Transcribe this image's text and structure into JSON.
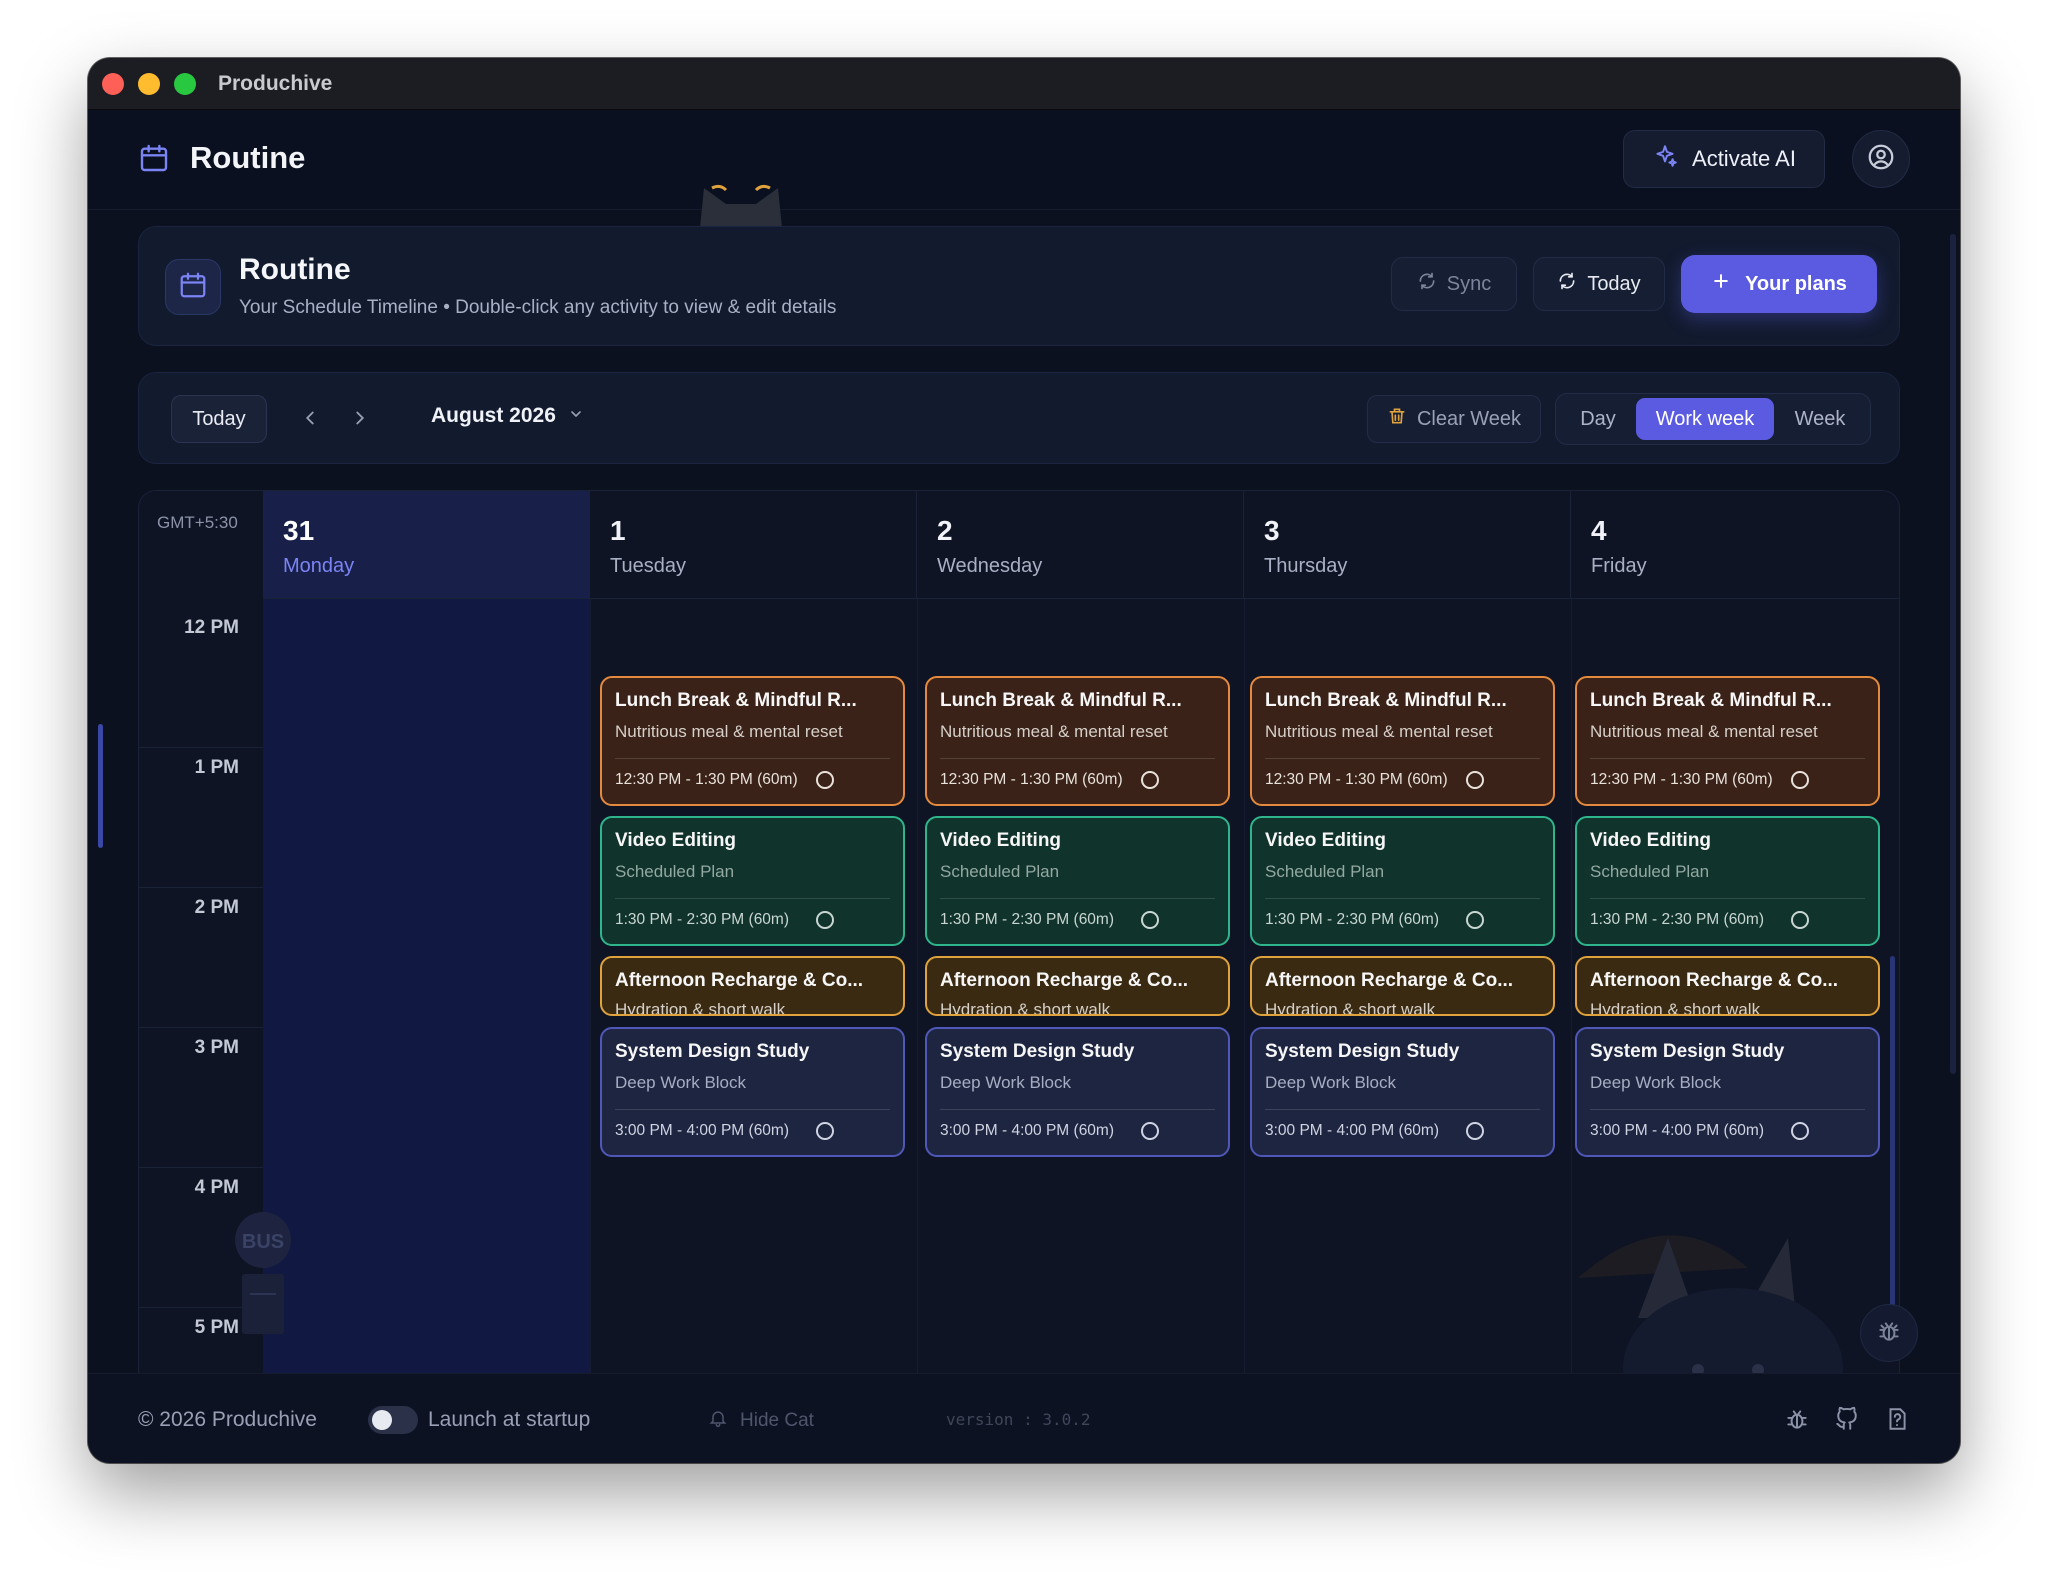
{
  "window": {
    "title": "Produchive"
  },
  "header": {
    "title": "Routine",
    "activate_ai": "Activate AI"
  },
  "routine_card": {
    "title": "Routine",
    "subtitle": "Your Schedule Timeline • Double-click any activity to view & edit details",
    "sync": "Sync",
    "today": "Today",
    "your_plans": "Your plans"
  },
  "toolbar": {
    "today": "Today",
    "month": "August 2026",
    "clear_week": "Clear Week",
    "views": {
      "day": "Day",
      "work_week": "Work week",
      "week": "Week"
    },
    "selected_view": "Work week"
  },
  "calendar": {
    "timezone": "GMT+5:30",
    "days": [
      {
        "num": "31",
        "name": "Monday",
        "today": true
      },
      {
        "num": "1",
        "name": "Tuesday"
      },
      {
        "num": "2",
        "name": "Wednesday"
      },
      {
        "num": "3",
        "name": "Thursday"
      },
      {
        "num": "4",
        "name": "Friday"
      }
    ],
    "times": [
      "12 PM",
      "1 PM",
      "2 PM",
      "3 PM",
      "4 PM",
      "5 PM"
    ],
    "events": [
      {
        "title": "Lunch Break & Mindful R...",
        "subtitle": "Nutritious meal & mental reset",
        "time": "12:30 PM - 1:30 PM (60m)",
        "color": "#e48a3e"
      },
      {
        "title": "Video Editing",
        "subtitle": "Scheduled Plan",
        "time": "1:30 PM - 2:30 PM (60m)",
        "color": "#2fb58c"
      },
      {
        "title": "Afternoon Recharge & Co...",
        "subtitle": "Hydration & short walk",
        "time": "",
        "color": "#e0a23c"
      },
      {
        "title": "System Design Study",
        "subtitle": "Deep Work Block",
        "time": "3:00 PM - 4:00 PM (60m)",
        "color": "#4f58b8"
      }
    ]
  },
  "footer": {
    "copyright": "© 2026 Produchive",
    "launch_at_startup": "Launch at startup",
    "hide_cat": "Hide Cat",
    "version": "version : 3.0.2"
  },
  "decor": {
    "bus_sign": "BUS"
  },
  "colors": {
    "accent": "#5a5be0",
    "background": "#0c1120"
  }
}
